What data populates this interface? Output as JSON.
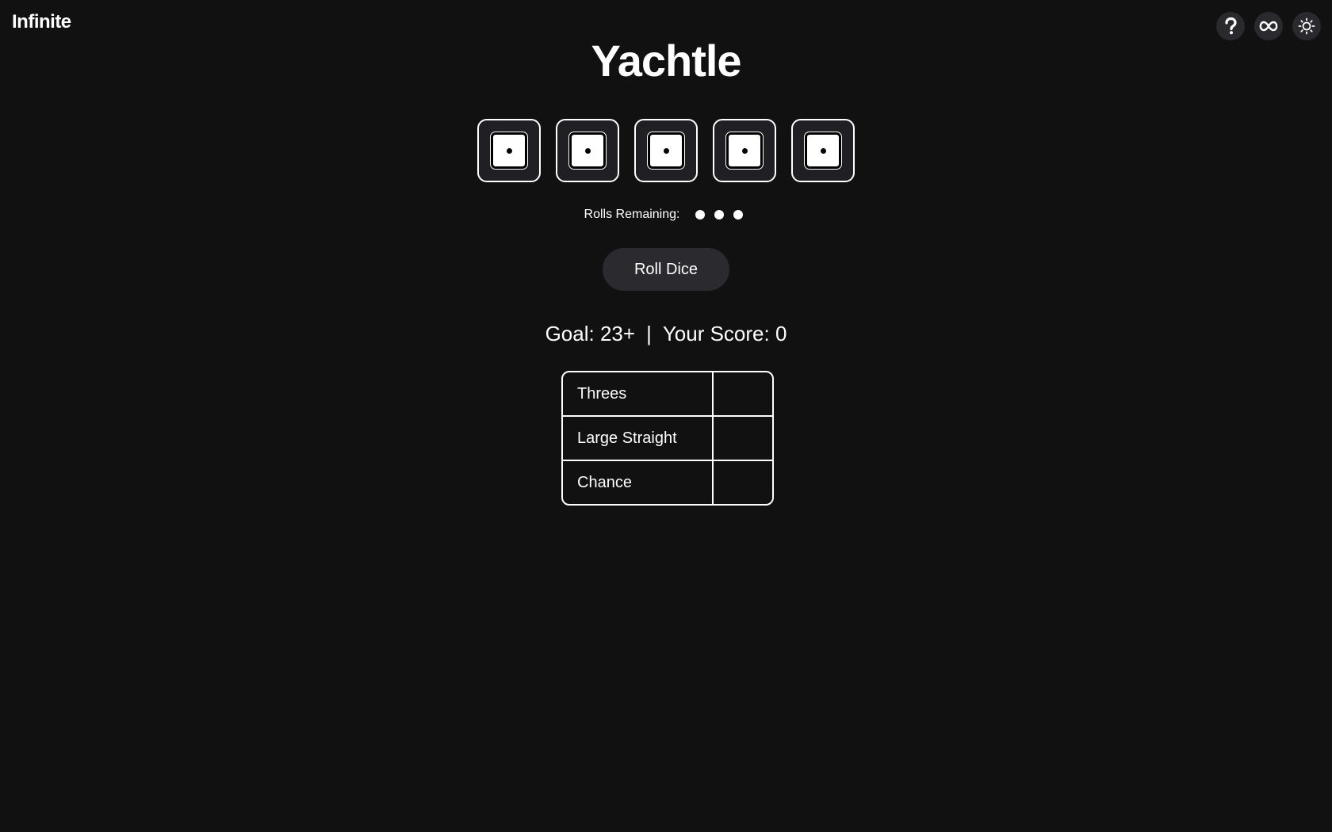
{
  "header": {
    "brand": "Infinite",
    "icons": [
      "help-icon",
      "infinity-icon",
      "sun-icon"
    ]
  },
  "game": {
    "title": "Yachtle",
    "dice": [
      1,
      1,
      1,
      1,
      1
    ],
    "rolls_label": "Rolls Remaining:",
    "rolls_remaining": 3,
    "roll_button": "Roll Dice",
    "goal_text": "Goal: 23+",
    "separator": "|",
    "score_text": "Your Score: 0"
  },
  "scorecard": [
    {
      "category": "Threes",
      "score": ""
    },
    {
      "category": "Large Straight",
      "score": ""
    },
    {
      "category": "Chance",
      "score": ""
    }
  ],
  "colors": {
    "background": "#111111",
    "panel": "#2a2a2e",
    "text": "#ffffff"
  }
}
